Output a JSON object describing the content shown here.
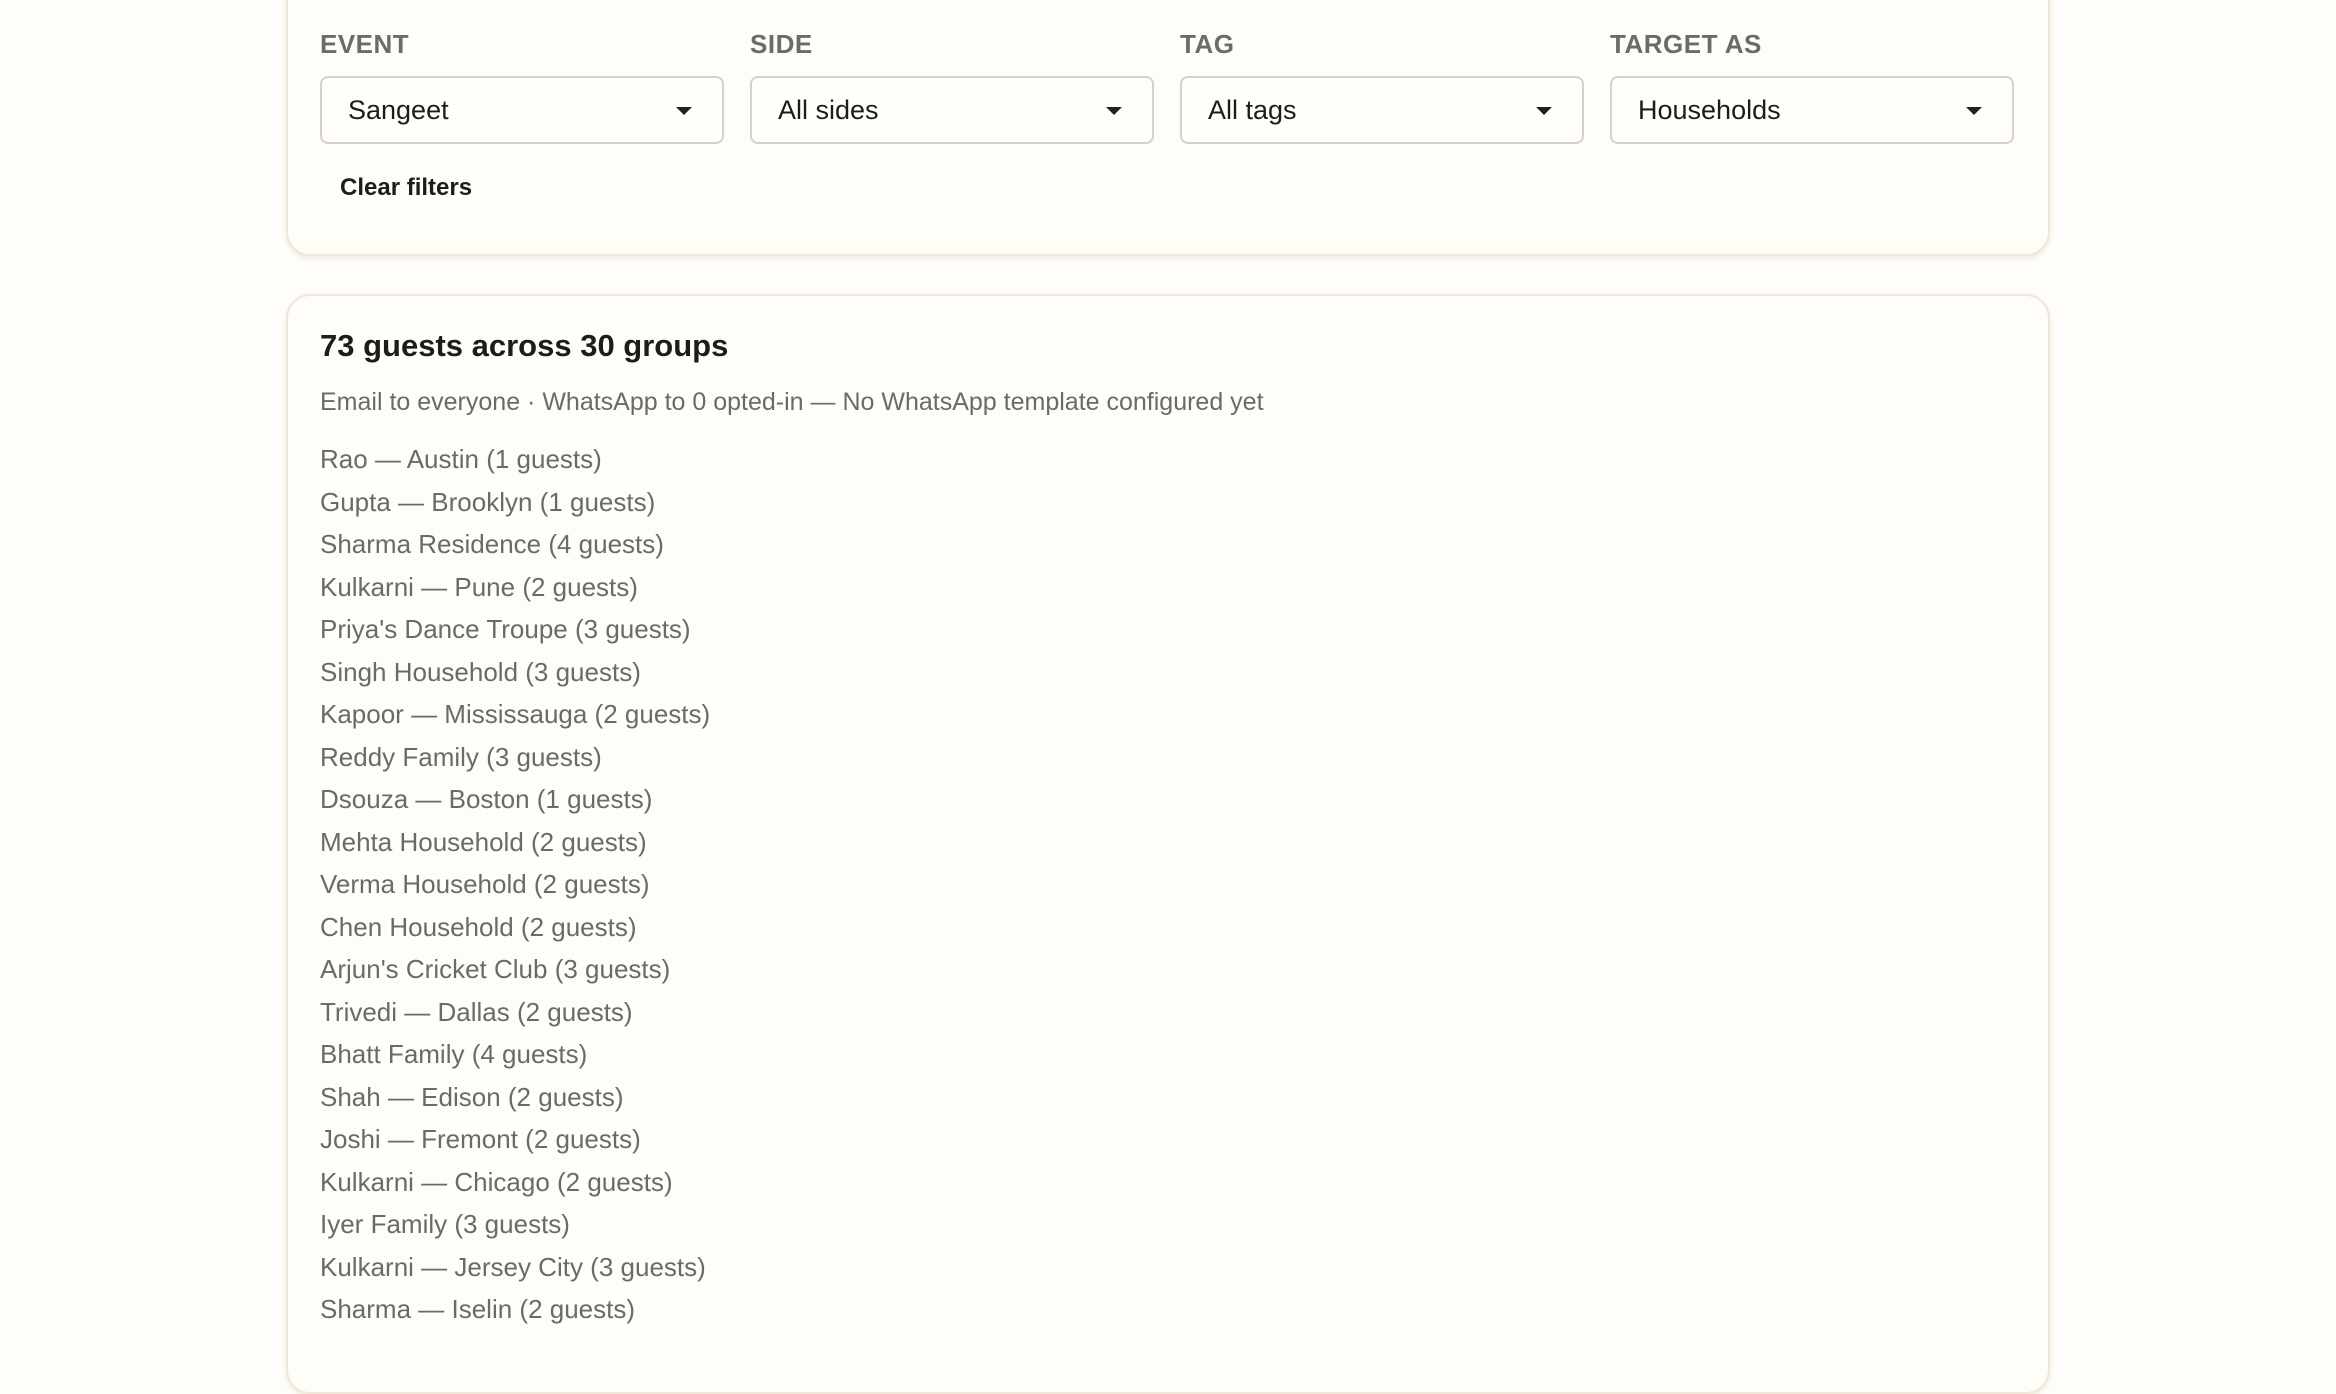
{
  "filters": {
    "event": {
      "label": "EVENT",
      "value": "Sangeet"
    },
    "side": {
      "label": "SIDE",
      "value": "All sides"
    },
    "tag": {
      "label": "TAG",
      "value": "All tags"
    },
    "target": {
      "label": "TARGET AS",
      "value": "Households"
    },
    "clear_label": "Clear filters"
  },
  "results": {
    "title": "73 guests across 30 groups",
    "subtitle": "Email to everyone · WhatsApp to 0 opted-in — No WhatsApp template configured yet",
    "groups": [
      "Rao — Austin (1 guests)",
      "Gupta — Brooklyn (1 guests)",
      "Sharma Residence (4 guests)",
      "Kulkarni — Pune (2 guests)",
      "Priya's Dance Troupe (3 guests)",
      "Singh Household (3 guests)",
      "Kapoor — Mississauga (2 guests)",
      "Reddy Family (3 guests)",
      "Dsouza — Boston (1 guests)",
      "Mehta Household (2 guests)",
      "Verma Household (2 guests)",
      "Chen Household (2 guests)",
      "Arjun's Cricket Club (3 guests)",
      "Trivedi — Dallas (2 guests)",
      "Bhatt Family (4 guests)",
      "Shah — Edison (2 guests)",
      "Joshi — Fremont (2 guests)",
      "Kulkarni — Chicago (2 guests)",
      "Iyer Family (3 guests)",
      "Kulkarni — Jersey City (3 guests)",
      "Sharma — Iselin (2 guests)"
    ]
  }
}
